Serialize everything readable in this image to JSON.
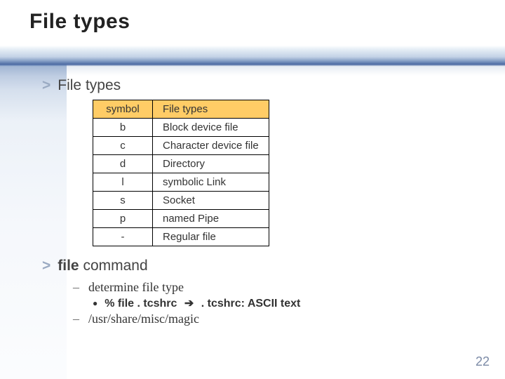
{
  "title": "File types",
  "bullets": {
    "file_types_heading": "File types",
    "file_command_bold": "file",
    "file_command_rest": " command"
  },
  "table": {
    "header": {
      "symbol": "symbol",
      "type": "File types"
    },
    "rows": [
      {
        "sym": "b",
        "desc": "Block device file"
      },
      {
        "sym": "c",
        "desc": "Character device file"
      },
      {
        "sym": "d",
        "desc": "Directory"
      },
      {
        "sym": "l",
        "desc": "symbolic Link"
      },
      {
        "sym": "s",
        "desc": "Socket"
      },
      {
        "sym": "p",
        "desc": "named Pipe"
      },
      {
        "sym": "-",
        "desc": "Regular file"
      }
    ]
  },
  "sub": {
    "determine": "determine file type",
    "example_cmd": "% file . tcshrc",
    "example_out": " . tcshrc: ASCII text",
    "magic": "/usr/share/misc/magic"
  },
  "page": "22"
}
